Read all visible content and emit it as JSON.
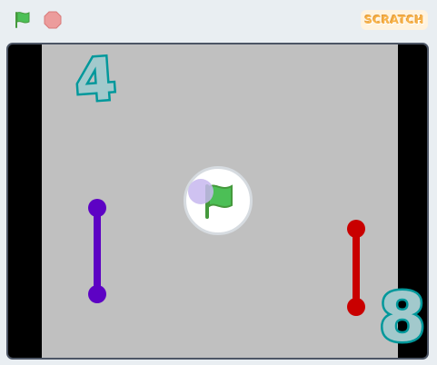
{
  "toolbar": {
    "green_flag_icon": "green-flag-icon",
    "stop_icon": "stop-sign-icon",
    "brand_text": "SCRATCH"
  },
  "stage": {
    "field_color": "#c0c0c0",
    "wall_color": "#000000",
    "left_score": "4",
    "right_score": "8",
    "score_color": "#00989b",
    "left_paddle_color": "#5d02c4",
    "right_paddle_color": "#c90000",
    "ball_color": "#c7b7ef",
    "overlay_icon": "green-flag-icon"
  }
}
